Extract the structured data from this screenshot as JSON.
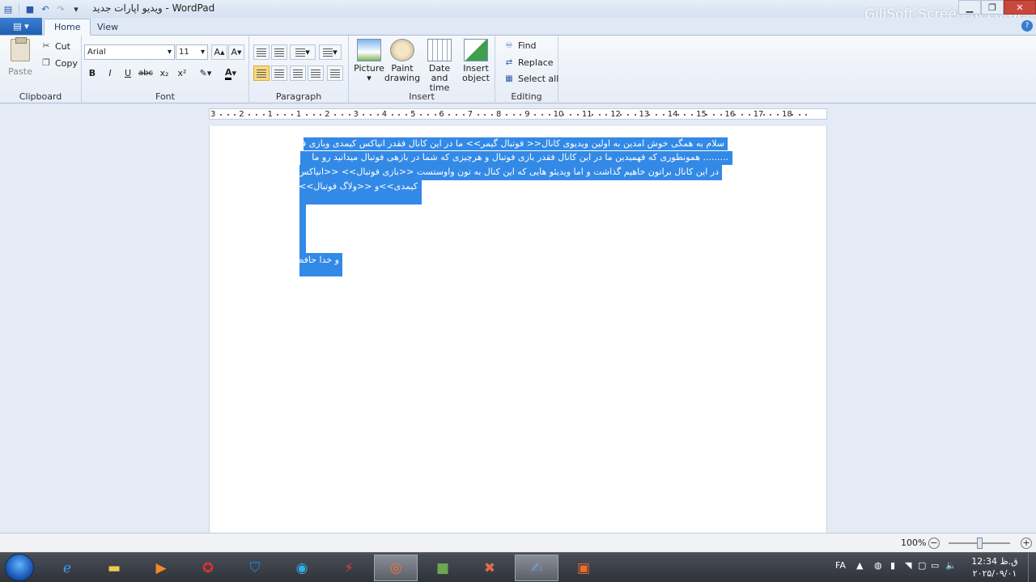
{
  "window": {
    "title": "ویدیو اپارات جدید - WordPad",
    "watermark": "GiliSoft Screen Recorder"
  },
  "tabs": [
    {
      "label": "Home"
    },
    {
      "label": "View"
    }
  ],
  "clipboard": {
    "paste": "Paste",
    "cut": "Cut",
    "copy": "Copy",
    "group_label": "Clipboard"
  },
  "font": {
    "family": "Arial",
    "size": "11",
    "group_label": "Font"
  },
  "paragraph": {
    "group_label": "Paragraph"
  },
  "insert": {
    "picture": "Picture",
    "paint_1": "Paint",
    "paint_2": "drawing",
    "date_1": "Date and",
    "date_2": "time",
    "object_1": "Insert",
    "object_2": "object",
    "group_label": "Insert"
  },
  "editing": {
    "find": "Find",
    "replace": "Replace",
    "select_all": "Select all",
    "group_label": "Editing"
  },
  "ruler": {
    "labels": [
      "3",
      "2",
      "1",
      "1",
      "2",
      "3",
      "4",
      "5",
      "6",
      "7",
      "8",
      "9",
      "10",
      "11",
      "12",
      "13",
      "14",
      "15",
      "16",
      "17",
      "18"
    ]
  },
  "document": {
    "lines": [
      "سلام به همگی خوش امدین به اولین ویدیوی کانال<< فوتبال گیمر>> ما در این کانال فقدر انیاکس کیمدی وبازی فیفا",
      "......... همونطوری که فهمیدین ما در این کانال فقدر بازی فوتبال و هرچیزی که شما در بازهی فوتبال میدانید رو ما",
      "در این کانال براتون خاهیم گذاشت  و اما ویدیئو هایی که این کنال به تون واوستست <<بازی فوتبال>> <<انیاکس",
      "کیمدی>>و <<ولاگ فوتبال>>"
    ],
    "footer_line": "و خدا حافظ"
  },
  "status": {
    "zoom": "100%"
  },
  "taskbar": {
    "language": "FA",
    "time": "ق.ظ 12:34",
    "date": "۲۰۲۵/۰۹/۰۱"
  }
}
